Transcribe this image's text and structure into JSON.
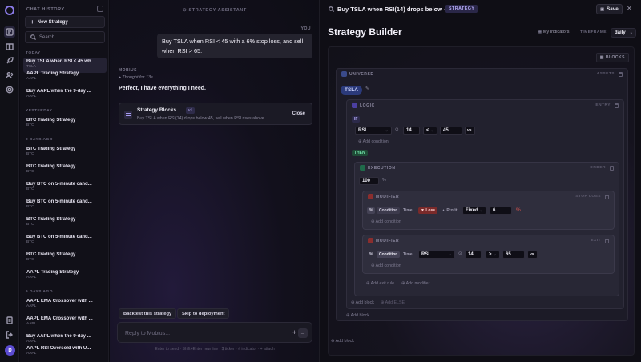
{
  "sidebar_rail": {
    "avatar_initial": "D"
  },
  "history": {
    "title": "CHAT HISTORY",
    "new_strategy": "New Strategy",
    "search_placeholder": "Search...",
    "groups": [
      {
        "label": "TODAY"
      },
      {
        "label": "YESTERDAY"
      },
      {
        "label": "2 DAYS AGO"
      },
      {
        "label": "6 DAYS AGO"
      }
    ],
    "items": [
      {
        "title": "Buy TSLA when RSI < 45 wh...",
        "sub": "TSLA"
      },
      {
        "title": "AAPL Trading Strategy",
        "sub": "AAPL"
      },
      {
        "title": "Buy AAPL when the 9-day ...",
        "sub": "AAPL"
      },
      {
        "title": "BTC Trading Strategy",
        "sub": "BTC"
      },
      {
        "title": "BTC Trading Strategy",
        "sub": "BTC"
      },
      {
        "title": "BTC Trading Strategy",
        "sub": "BTC"
      },
      {
        "title": "Buy BTC on 5-minute cand...",
        "sub": "BTC"
      },
      {
        "title": "Buy BTC on 5-minute cand...",
        "sub": "BTC"
      },
      {
        "title": "BTC Trading Strategy",
        "sub": "BTC"
      },
      {
        "title": "Buy BTC on 5-minute cand...",
        "sub": "BTC"
      },
      {
        "title": "BTC Trading Strategy",
        "sub": "BTC"
      },
      {
        "title": "AAPL Trading Strategy",
        "sub": "AAPL"
      },
      {
        "title": "AAPL EMA Crossover with ...",
        "sub": "AAPL"
      },
      {
        "title": "AAPL EMA Crossover with ...",
        "sub": "AAPL"
      },
      {
        "title": "Buy AAPL when the 9-day ...",
        "sub": "AAPL"
      },
      {
        "title": "AAPL RSI Oversold with U...",
        "sub": "AAPL"
      }
    ]
  },
  "chat": {
    "title": "STRATEGY ASSISTANT",
    "you_label": "YOU",
    "user_message": "Buy TSLA when RSI < 45 with a 6% stop loss, and sell when RSI > 65.",
    "assistant_label": "MOBIUS",
    "thought": "Thought for 13s",
    "reply": "Perfect, I have everything I need.",
    "card": {
      "title": "Strategy Blocks",
      "version": "v1",
      "description": "Buy TSLA when RSI(14) drops below 45, sell when RSI rises above ...",
      "close": "Close"
    },
    "suggestions": [
      "Backtest this strategy",
      "Skip to deployment"
    ],
    "input_placeholder": "Reply to Mobius...",
    "hint": "Enter to send · Shift+Enter new line · $ ticker · # indicator · + attach"
  },
  "topbar": {
    "title": "Buy TSLA when RSI(14) drops below 45, ...",
    "badge": "STRATEGY",
    "save": "Save"
  },
  "builder": {
    "title": "Strategy Builder",
    "my_indicators": "My Indicators",
    "timeframe_label": "TIMEFRAME",
    "timeframe_value": "daily",
    "blocks_button": "BLOCKS",
    "universe": {
      "label": "UNIVERSE",
      "right": "ASSETS",
      "asset": "TSLA"
    },
    "logic": {
      "label": "LOGIC",
      "right": "ENTRY",
      "if_label": "IF",
      "indicator": "RSI",
      "period": "14",
      "operator": "<",
      "value": "45",
      "vs": "vs",
      "add_condition": "Add condition",
      "then_label": "THEN"
    },
    "execution": {
      "label": "EXECUTION",
      "right": "ORDER",
      "quantity": "100",
      "unit": "%"
    },
    "modifier1": {
      "label": "MODIFIER",
      "right": "STOP LOSS",
      "pct": "%",
      "condition": "Condition",
      "time": "Time",
      "loss": "Loss",
      "profit": "Profit",
      "mode": "Fixed",
      "value": "6",
      "unit": "%",
      "add_condition": "Add condition"
    },
    "modifier2": {
      "label": "MODIFIER",
      "right": "EXIT",
      "pct": "%",
      "condition": "Condition",
      "time": "Time",
      "indicator": "RSI",
      "period": "14",
      "operator": ">",
      "value": "65",
      "vs": "vs",
      "add_condition": "Add condition"
    },
    "add_exit_rule": "Add exit rule",
    "add_modifier": "Add modifier",
    "add_block_inner": "Add block",
    "add_else": "Add ELSE",
    "add_block_mid": "Add block",
    "add_block_outer": "Add block"
  },
  "colors": {
    "accent": "#7c6cf0",
    "bg": "#0c0b12",
    "loss_red": "#d94b4b",
    "then_green": "#3ecf8e",
    "modifier_red": "#e2564f"
  }
}
